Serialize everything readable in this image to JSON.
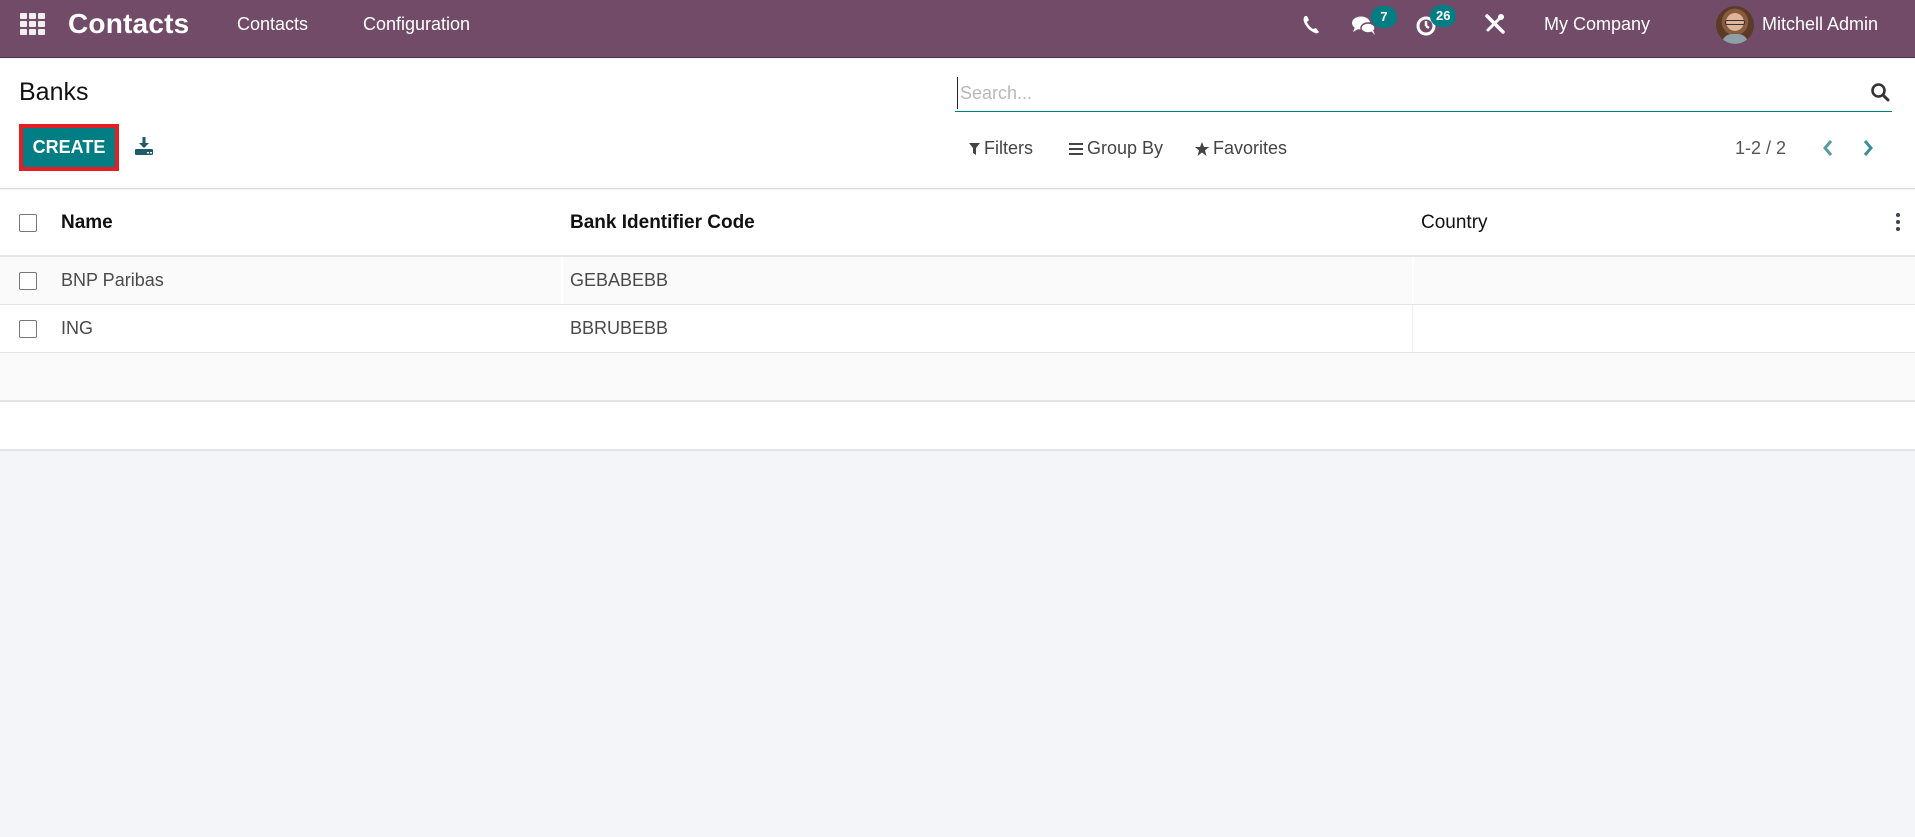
{
  "navbar": {
    "app_name": "Contacts",
    "menus": [
      {
        "label": "Contacts"
      },
      {
        "label": "Configuration"
      }
    ],
    "icons": {
      "apps": "apps-grid-icon",
      "phone": "phone-icon",
      "messages": "chat-icon",
      "activities": "clock-icon",
      "debug": "tools-icon"
    },
    "messages_count": "7",
    "activities_count": "26",
    "company": "My Company",
    "user_name": "Mitchell Admin"
  },
  "control_panel": {
    "title": "Banks",
    "create_label": "CREATE",
    "download_icon": "download-icon",
    "search": {
      "placeholder": "Search...",
      "value": ""
    },
    "filters_label": "Filters",
    "group_by_label": "Group By",
    "favorites_label": "Favorites",
    "pager": {
      "value": "1-2 / 2"
    }
  },
  "list": {
    "columns": [
      {
        "label": "Name"
      },
      {
        "label": "Bank Identifier Code"
      },
      {
        "label": "Country"
      }
    ],
    "rows": [
      {
        "name": "BNP Paribas",
        "bic": "GEBABEBB",
        "country": ""
      },
      {
        "name": "ING",
        "bic": "BBRUBEBB",
        "country": ""
      }
    ]
  },
  "colors": {
    "navbar": "#714b67",
    "primary": "#017e84",
    "highlight_border": "#e31e24",
    "background": "#f4f5f8"
  }
}
